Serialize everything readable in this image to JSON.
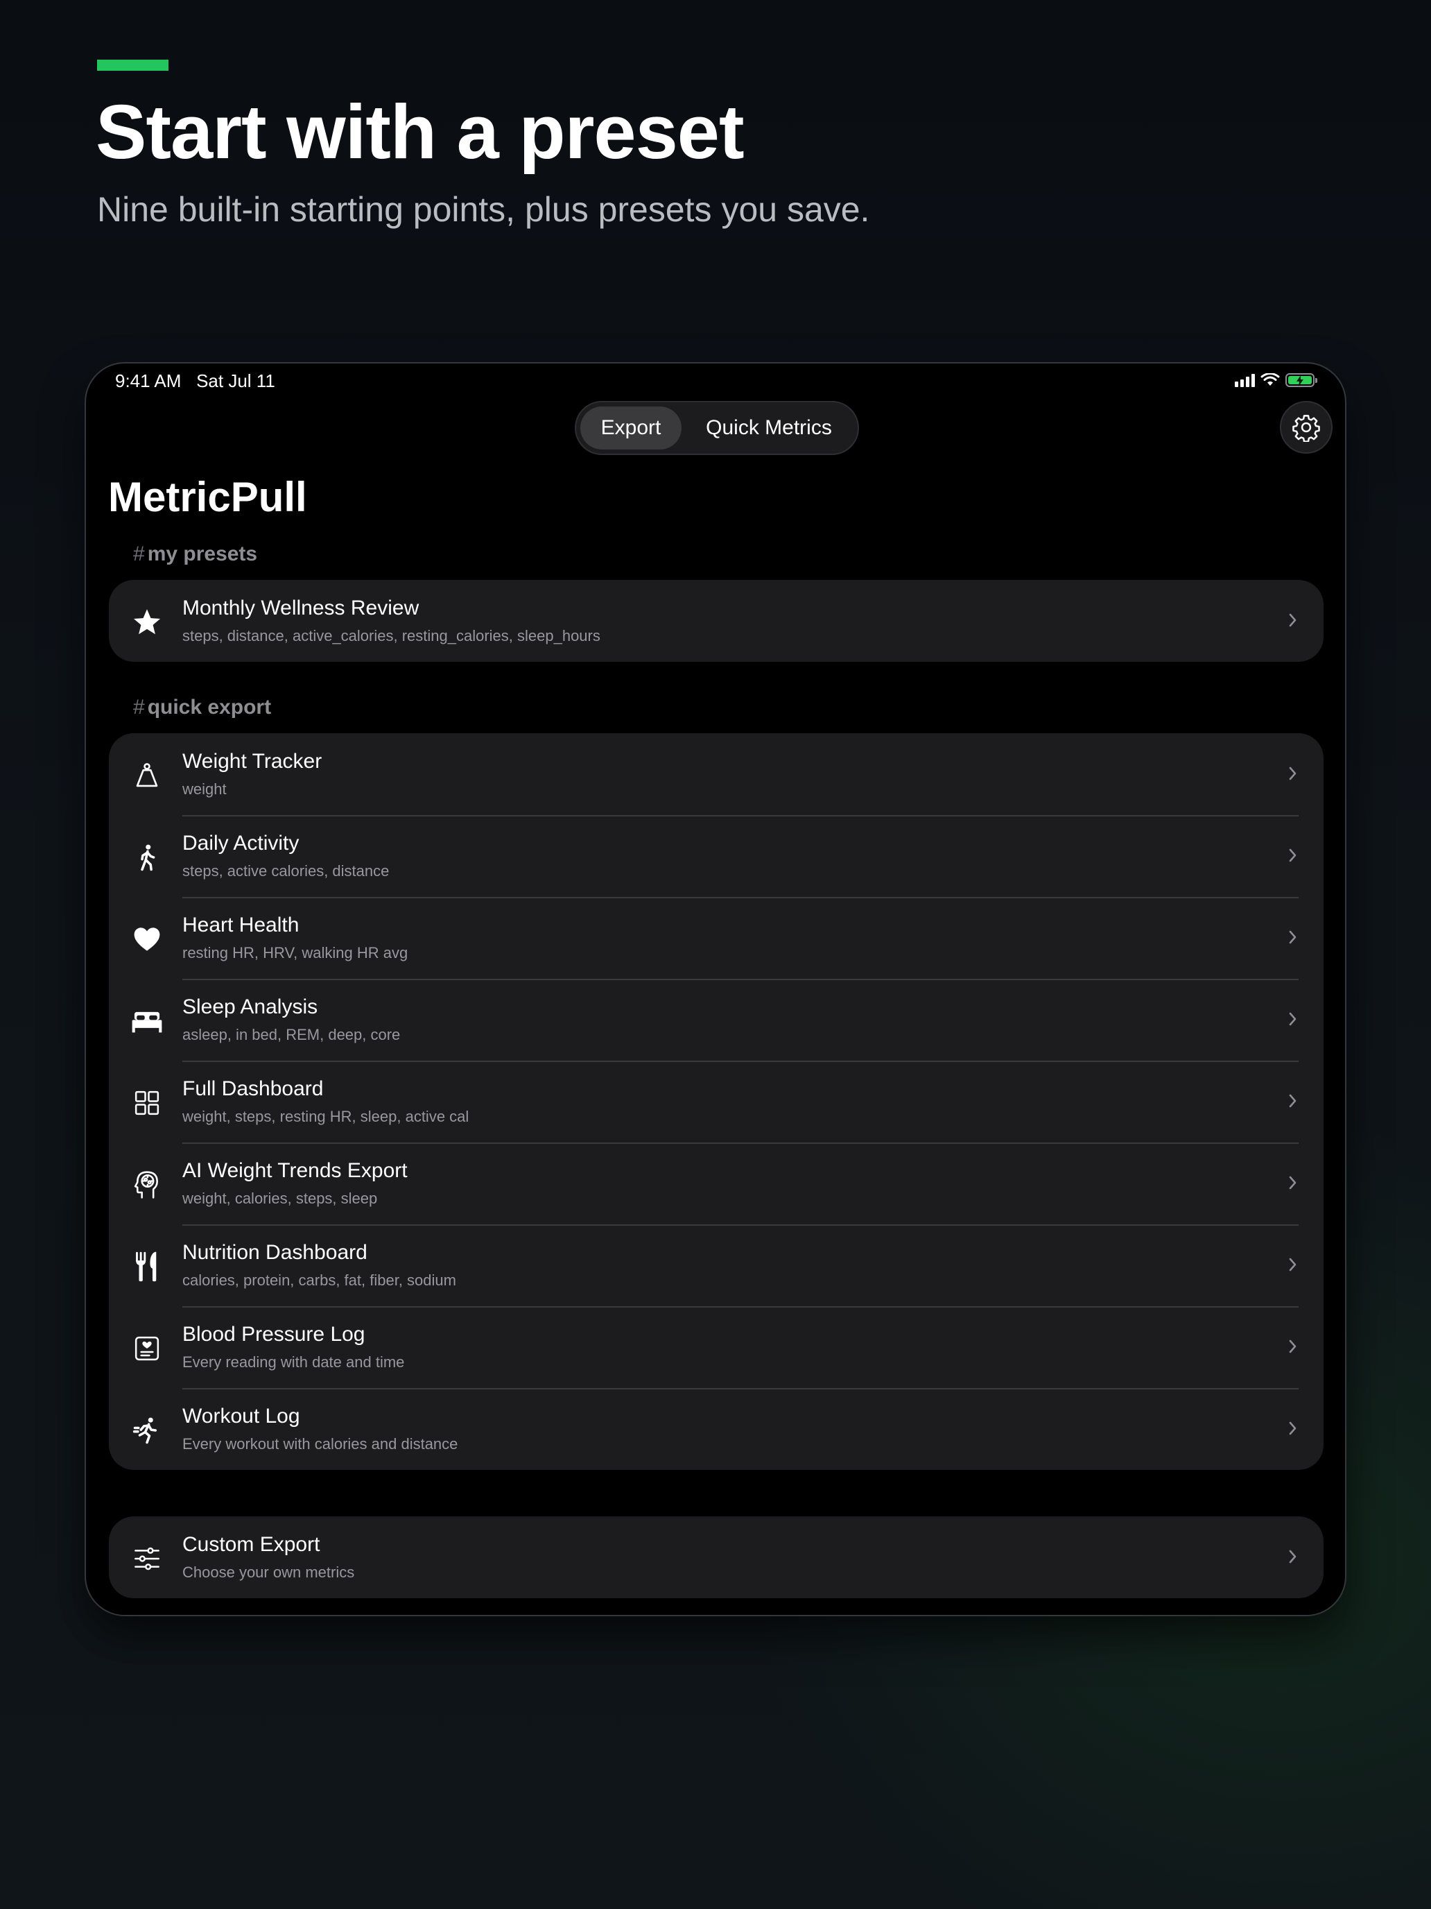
{
  "page": {
    "headline": "Start with a preset",
    "subheadline": "Nine built-in starting points, plus presets you save.",
    "accent_color": "#22c55e"
  },
  "status_bar": {
    "time": "9:41 AM",
    "date": "Sat Jul 11",
    "icons": [
      "cellular-signal-icon",
      "wifi-icon",
      "battery-charging-icon"
    ]
  },
  "segmented_control": {
    "options": [
      "Export",
      "Quick Metrics"
    ],
    "selected": "Export"
  },
  "settings_icon": "gear-icon",
  "app": {
    "title": "MetricPull",
    "my_presets": {
      "hash": "#",
      "header": "my presets",
      "items": [
        {
          "title": "Monthly Wellness Review",
          "subtitle": "steps, distance, active_calories, resting_calories, sleep_hours",
          "icon": "star-icon"
        }
      ]
    },
    "quick_export": {
      "hash": "#",
      "header": "quick export",
      "items": [
        {
          "title": "Weight Tracker",
          "subtitle": "weight",
          "icon": "scale-weight-icon"
        },
        {
          "title": "Daily Activity",
          "subtitle": "steps, active calories, distance",
          "icon": "walking-figure-icon"
        },
        {
          "title": "Heart Health",
          "subtitle": "resting HR, HRV, walking HR avg",
          "icon": "heart-icon"
        },
        {
          "title": "Sleep Analysis",
          "subtitle": "asleep, in bed, REM, deep, core",
          "icon": "bed-icon"
        },
        {
          "title": "Full Dashboard",
          "subtitle": "weight, steps, resting HR, sleep, active cal",
          "icon": "grid-icon"
        },
        {
          "title": "AI Weight Trends Export",
          "subtitle": "weight, calories, steps, sleep",
          "icon": "brain-head-icon"
        },
        {
          "title": "Nutrition Dashboard",
          "subtitle": "calories, protein, carbs, fat, fiber, sodium",
          "icon": "fork-knife-icon"
        },
        {
          "title": "Blood Pressure Log",
          "subtitle": "Every reading with date and time",
          "icon": "heart-document-icon"
        },
        {
          "title": "Workout Log",
          "subtitle": "Every workout with calories and distance",
          "icon": "running-figure-icon"
        }
      ]
    },
    "custom_export": {
      "title": "Custom Export",
      "subtitle": "Choose your own metrics",
      "icon": "sliders-icon"
    }
  }
}
